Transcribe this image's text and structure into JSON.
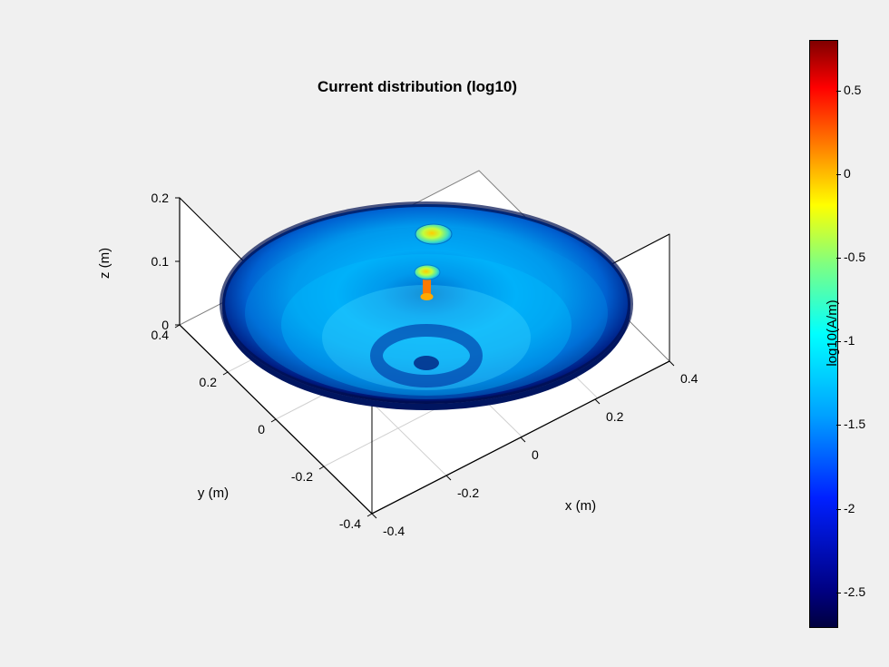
{
  "chart_data": {
    "type": "surface3d",
    "title": "Current distribution (log10)",
    "xlabel": "x (m)",
    "ylabel": "y (m)",
    "zlabel": "z (m)",
    "x_ticks": [
      -0.4,
      -0.2,
      0,
      0.2,
      0.4
    ],
    "y_ticks": [
      -0.4,
      -0.2,
      0,
      0.2,
      0.4
    ],
    "z_ticks": [
      0,
      0.1,
      0.2
    ],
    "colorbar": {
      "label": "log10(A/m)",
      "ticks": [
        -2.5,
        -2,
        -1.5,
        -1,
        -0.5,
        0,
        0.5
      ],
      "range": [
        -2.7,
        0.8
      ]
    },
    "description": "Parabolic reflector dish with surface current magnitude (log10 A/m). Outer rim dark blue (~-2.5), increasing to cyan toward center (~-2 to -1.5), darker ring near apex. Small feed subreflector above dish shows green/yellow/orange (~-0.5 to 0). Feed column below subreflector orange (~0)."
  }
}
